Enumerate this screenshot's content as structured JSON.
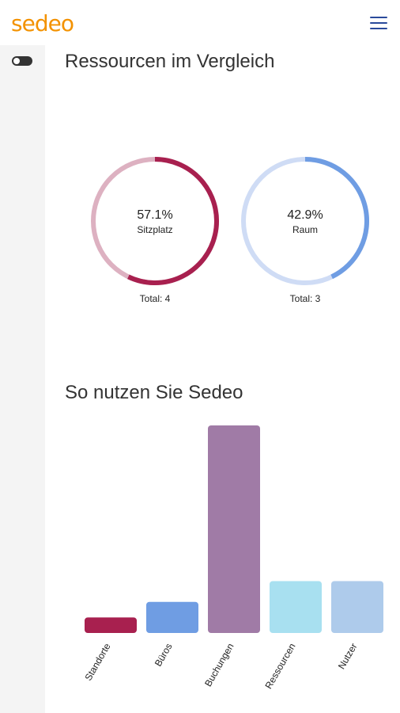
{
  "app": {
    "logo_text": "sedeo"
  },
  "header": {
    "menu_icon": "hamburger-menu-icon"
  },
  "sidebar": {
    "toggle_icon": "toggle-switch-icon"
  },
  "sections": {
    "comparison_title": "Ressourcen im Vergleich",
    "usage_title": "So nutzen Sie Sedeo"
  },
  "chart_data": [
    {
      "type": "pie",
      "chart": "donut",
      "value_label": "57.1%",
      "value": 57.1,
      "label": "Sitzplatz",
      "total_label": "Total: 4",
      "total": 4,
      "color": "#a8204f",
      "track_color": "#ddb1c1"
    },
    {
      "type": "pie",
      "chart": "donut",
      "value_label": "42.9%",
      "value": 42.9,
      "label": "Raum",
      "total_label": "Total: 3",
      "total": 3,
      "color": "#6f9de3",
      "track_color": "#cfdcf5"
    },
    {
      "type": "bar",
      "categories": [
        "Standorte",
        "Büros",
        "Buchungen",
        "Ressourcen",
        "Nutzer"
      ],
      "values": [
        1.5,
        3,
        20,
        5,
        5
      ],
      "colors": [
        "#a8204f",
        "#6f9de3",
        "#a07ba6",
        "#a8e0f0",
        "#aecbeb"
      ],
      "ylim": [
        0,
        20
      ],
      "grid": false,
      "legend": "none"
    }
  ]
}
